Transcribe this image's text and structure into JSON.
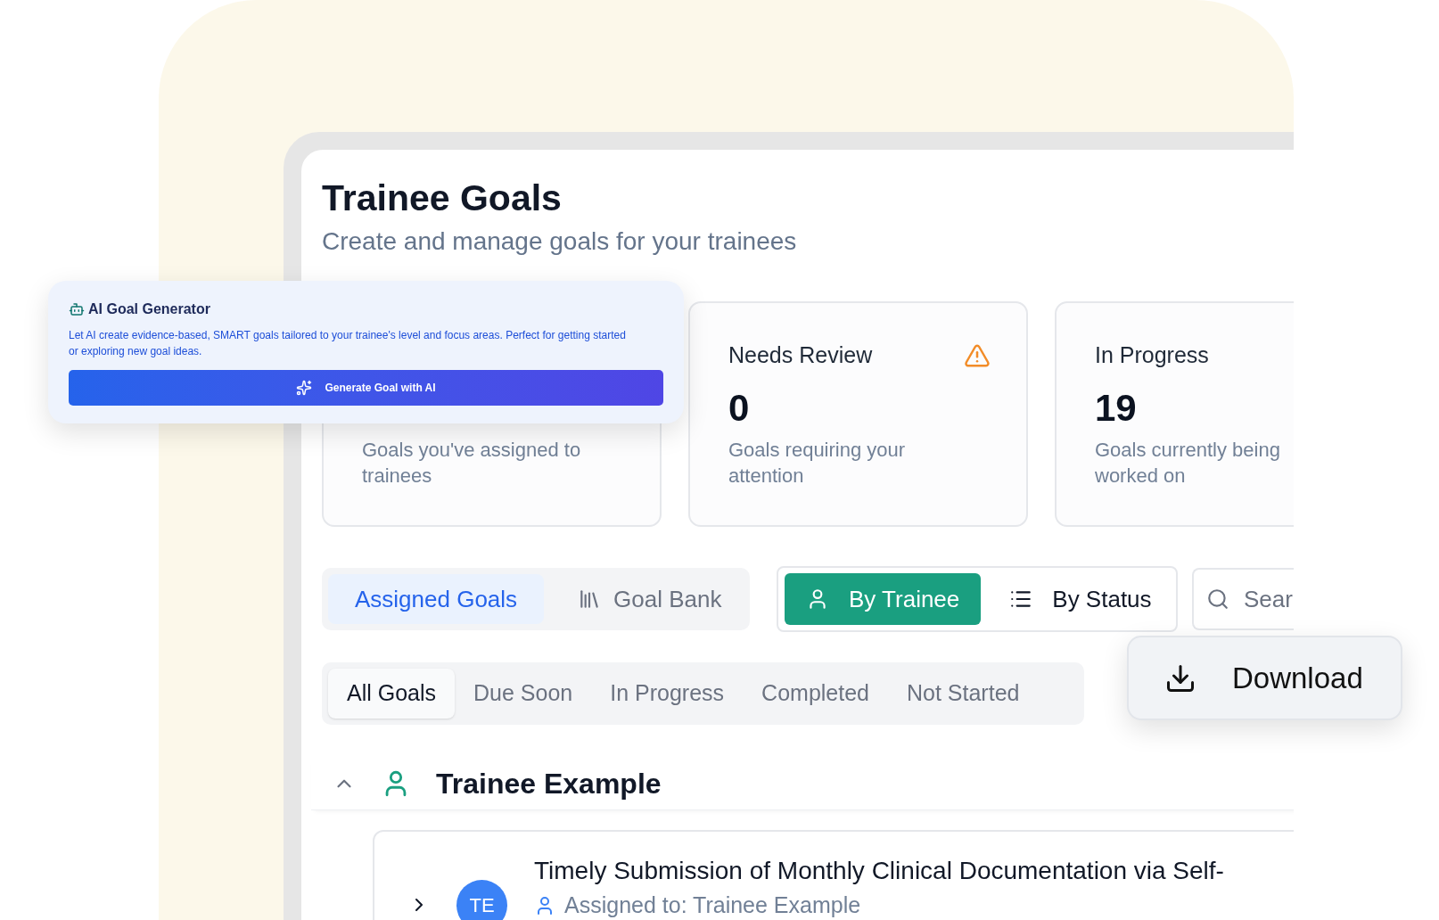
{
  "page": {
    "title": "Trainee Goals",
    "subtitle": "Create and manage goals for your trainees"
  },
  "stat_cards": [
    {
      "kind": "plain",
      "description": "Goals you've assigned to trainees"
    },
    {
      "kind": "alert",
      "title": "Needs Review",
      "value": "0",
      "description": "Goals requiring your attention"
    },
    {
      "kind": "plain",
      "title": "In Progress",
      "value": "19",
      "description": "Goals currently being worked on"
    }
  ],
  "source_tabs": [
    {
      "label": "Assigned Goals",
      "selected": true,
      "kind": "plain"
    },
    {
      "label": "Goal Bank",
      "selected": false,
      "kind": "library"
    }
  ],
  "view_toggle": [
    {
      "label": "By Trainee",
      "selected": true,
      "kind": "person"
    },
    {
      "label": "By Status",
      "selected": false,
      "kind": "list"
    }
  ],
  "search": {
    "placeholder": "Sear"
  },
  "filters": [
    {
      "label": "All Goals",
      "selected": true
    },
    {
      "label": "Due Soon",
      "selected": false
    },
    {
      "label": "In Progress",
      "selected": false
    },
    {
      "label": "Completed",
      "selected": false
    },
    {
      "label": "Not Started",
      "selected": false
    }
  ],
  "trainee_group": {
    "name": "Trainee Example",
    "expanded": true,
    "goals": [
      {
        "title": "Timely Submission of Monthly Clinical Documentation via Self-",
        "initials": "TE",
        "assigned": "Assigned to: Trainee Example",
        "expanded": false
      }
    ]
  },
  "ai_generator": {
    "title": "AI Goal Generator",
    "description": "Let AI create evidence-based, SMART goals tailored to your trainee's level and focus areas. Perfect for getting started or exploring new goal ideas.",
    "button": "Generate Goal with AI"
  },
  "download_popup": {
    "label": "Download"
  }
}
